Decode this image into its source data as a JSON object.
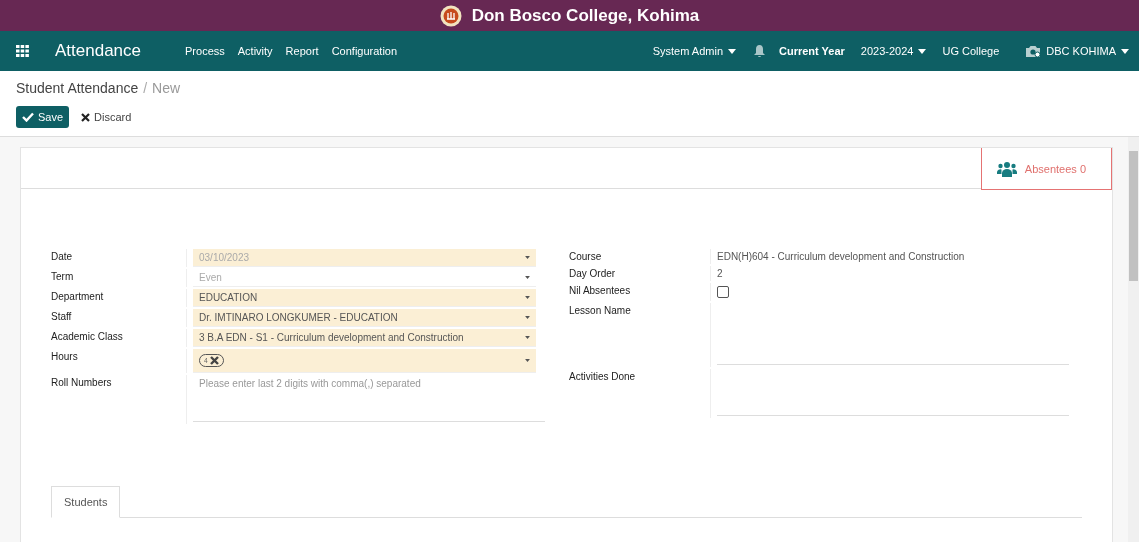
{
  "college": {
    "title": "Don Bosco College, Kohima"
  },
  "navbar": {
    "app": "Attendance",
    "menus": [
      "Process",
      "Activity",
      "Report",
      "Configuration"
    ],
    "user": "System Admin",
    "year_label": "Current Year",
    "year": "2023-2024",
    "college_type": "UG College",
    "company": "DBC KOHIMA"
  },
  "breadcrumb": {
    "parent": "Student Attendance",
    "separator": "/",
    "current": "New"
  },
  "actions": {
    "save": "Save",
    "discard": "Discard"
  },
  "smart_button": {
    "label": "Absentees",
    "count": "0"
  },
  "left_fields": [
    {
      "label": "Date",
      "kind": "select",
      "required": true,
      "value": "03/10/2023",
      "muted": true
    },
    {
      "label": "Term",
      "kind": "select",
      "required": false,
      "value": "Even",
      "muted": true
    },
    {
      "label": "Department",
      "kind": "select",
      "required": true,
      "value": "EDUCATION",
      "muted": false
    },
    {
      "label": "Staff",
      "kind": "select",
      "required": true,
      "value": "Dr. IMTINARO LONGKUMER - EDUCATION",
      "muted": false
    },
    {
      "label": "Academic Class",
      "kind": "select",
      "required": true,
      "value": "3 B.A EDN - S1 - Curriculum development and Construction",
      "muted": false
    },
    {
      "label": "Hours",
      "kind": "tags",
      "required": true,
      "tags": [
        "4"
      ]
    },
    {
      "label": "Roll Numbers",
      "kind": "textarea",
      "required": false,
      "placeholder": "Please enter last 2 digits with comma(,) separated"
    }
  ],
  "right_fields": [
    {
      "label": "Course",
      "kind": "text",
      "value": "EDN(H)604 - Curriculum development and Construction"
    },
    {
      "label": "Day Order",
      "kind": "text",
      "value": "2"
    },
    {
      "label": "Nil Absentees",
      "kind": "checkbox",
      "checked": false
    },
    {
      "label": "Lesson Name",
      "kind": "textarea"
    },
    {
      "label": "Activities Done",
      "kind": "textarea"
    }
  ],
  "tabs": [
    {
      "label": "Students",
      "selected": true
    }
  ]
}
